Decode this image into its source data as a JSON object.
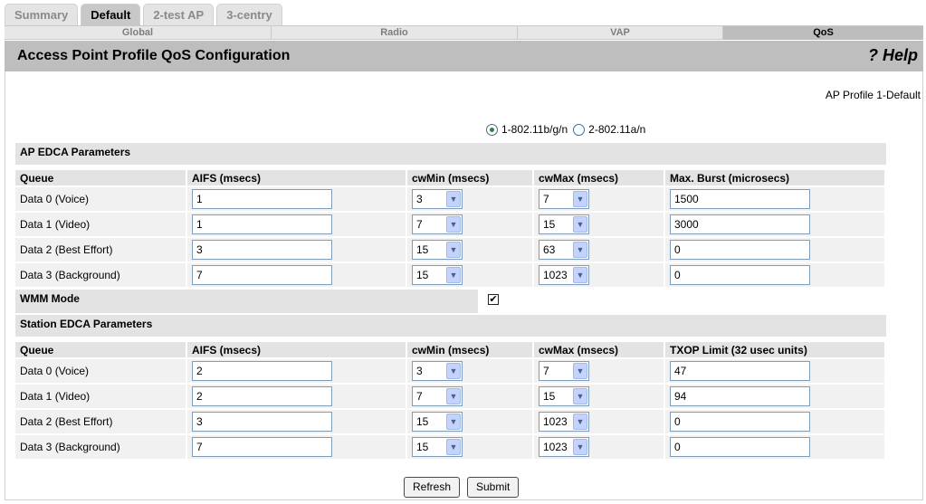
{
  "top_tabs": [
    "Summary",
    "Default",
    "2-test AP",
    "3-centry"
  ],
  "sub_tabs": [
    "Global",
    "Radio",
    "VAP",
    "QoS"
  ],
  "header": {
    "title": "Access Point Profile QoS Configuration",
    "help": "? Help"
  },
  "profile_label": "AP Profile 1-Default",
  "band": {
    "option1": "1-802.11b/g/n",
    "option2": "2-802.11a/n",
    "selected": "1-802.11b/g/n"
  },
  "ap_edca": {
    "title": "AP EDCA Parameters",
    "headers": [
      "Queue",
      "AIFS (msecs)",
      "cwMin (msecs)",
      "cwMax (msecs)",
      "Max. Burst (microsecs)"
    ],
    "rows": [
      {
        "queue": "Data 0 (Voice)",
        "aifs": "1",
        "cwmin": "3",
        "cwmax": "7",
        "last": "1500"
      },
      {
        "queue": "Data 1 (Video)",
        "aifs": "1",
        "cwmin": "7",
        "cwmax": "15",
        "last": "3000"
      },
      {
        "queue": "Data 2 (Best Effort)",
        "aifs": "3",
        "cwmin": "15",
        "cwmax": "63",
        "last": "0"
      },
      {
        "queue": "Data 3 (Background)",
        "aifs": "7",
        "cwmin": "15",
        "cwmax": "1023",
        "last": "0"
      }
    ]
  },
  "wmm": {
    "label": "WMM Mode",
    "checked": "✔"
  },
  "station_edca": {
    "title": "Station EDCA Parameters",
    "headers": [
      "Queue",
      "AIFS (msecs)",
      "cwMin (msecs)",
      "cwMax (msecs)",
      "TXOP Limit (32 usec units)"
    ],
    "rows": [
      {
        "queue": "Data 0 (Voice)",
        "aifs": "2",
        "cwmin": "3",
        "cwmax": "7",
        "last": "47"
      },
      {
        "queue": "Data 1 (Video)",
        "aifs": "2",
        "cwmin": "7",
        "cwmax": "15",
        "last": "94"
      },
      {
        "queue": "Data 2 (Best Effort)",
        "aifs": "3",
        "cwmin": "15",
        "cwmax": "1023",
        "last": "0"
      },
      {
        "queue": "Data 3 (Background)",
        "aifs": "7",
        "cwmin": "15",
        "cwmax": "1023",
        "last": "0"
      }
    ]
  },
  "buttons": {
    "refresh": "Refresh",
    "submit": "Submit"
  },
  "colors": {
    "header_bar": "#bebebe",
    "section_bg": "#e3e3e3",
    "cell_bg": "#f1f1f1"
  },
  "icons": {
    "select_arrow": "chevron-down-icon",
    "radio": "radio-icon",
    "checkbox": "checkmark-icon"
  }
}
